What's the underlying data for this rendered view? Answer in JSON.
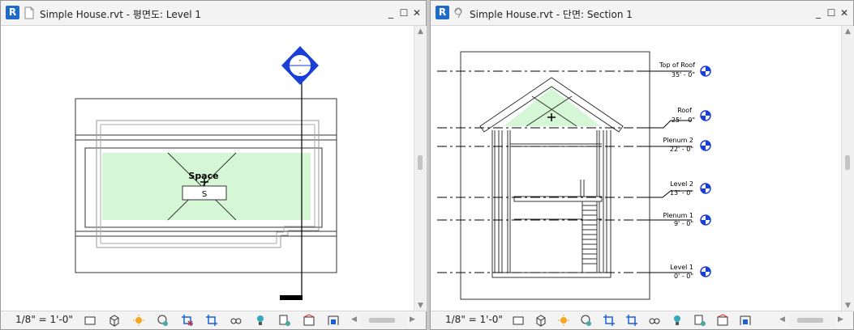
{
  "left_window": {
    "title": "Simple House.rvt - 평면도: Level 1",
    "logo": "R",
    "plan": {
      "room_name": "Space",
      "room_number": "S"
    },
    "scale": "1/8\" = 1'-0\""
  },
  "right_window": {
    "title": "Simple House.rvt - 단면: Section 1",
    "logo": "R",
    "levels": [
      {
        "name": "Top of Roof",
        "elevation": "35' - 0\""
      },
      {
        "name": "Roof",
        "elevation": "25' - 0\""
      },
      {
        "name": "Plenum 2",
        "elevation": "22' - 0\""
      },
      {
        "name": "Level 2",
        "elevation": "13' - 0\""
      },
      {
        "name": "Plenum 1",
        "elevation": "9' - 0\""
      },
      {
        "name": "Level 1",
        "elevation": "0' - 0\""
      }
    ],
    "scale": "1/8\" = 1'-0\""
  },
  "window_controls": {
    "minimize": "_",
    "maximize": "☐",
    "close": "✕"
  },
  "colors": {
    "revit_blue": "#1f6cc8",
    "space_fill": "#d6f7d6",
    "level_marker": "#1a3fd8"
  },
  "status_icons": [
    "detail-level-icon",
    "visual-style-icon",
    "sun-path-icon",
    "shadows-icon",
    "crop-view-icon",
    "show-crop-region-icon",
    "temporary-hide-icon",
    "reveal-hidden-icon",
    "analytical-model-icon",
    "highlight-displacement-icon",
    "reveal-constraints-icon"
  ]
}
